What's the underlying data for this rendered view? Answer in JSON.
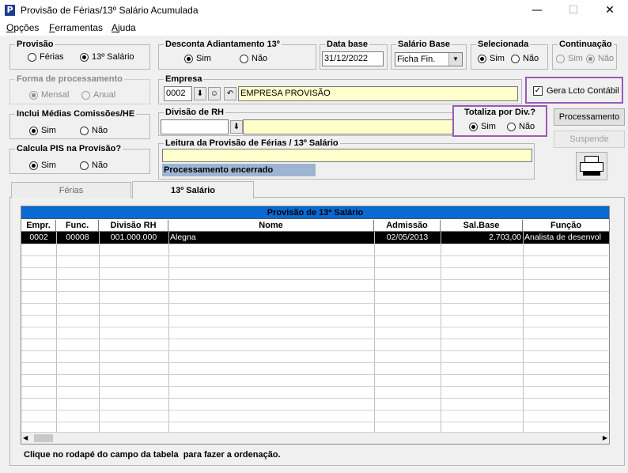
{
  "window": {
    "title": "Provisão de Férias/13º Salário Acumulada",
    "icon_letter": "P"
  },
  "menu": [
    "Opções",
    "Ferramentas",
    "Ajuda"
  ],
  "provisao": {
    "title": "Provisão",
    "opt1": "Férias",
    "opt2": "13º Salário",
    "selected": "13º Salário"
  },
  "desconta": {
    "title": "Desconta Adiantamento 13º",
    "opt1": "Sim",
    "opt2": "Não",
    "selected": "Sim"
  },
  "data_base": {
    "title": "Data base",
    "value": "31/12/2022"
  },
  "salario_base": {
    "title": "Salário Base",
    "value": "Ficha Fin."
  },
  "selecionada": {
    "title": "Selecionada",
    "opt1": "Sim",
    "opt2": "Não",
    "selected": "Sim"
  },
  "continuacao": {
    "title": "Continuação",
    "opt1": "Sim",
    "opt2": "Não",
    "selected": "Não",
    "disabled": true
  },
  "forma_processamento": {
    "title": "Forma de processamento",
    "opt1": "Mensal",
    "opt2": "Anual",
    "selected": "Mensal",
    "disabled": true
  },
  "empresa": {
    "title": "Empresa",
    "code": "0002",
    "name": "EMPRESA PROVISÃO"
  },
  "gera_lcto": {
    "label": "Gera Lcto Contábil",
    "checked": true
  },
  "inclui_medias": {
    "title": "Inclui Médias Comissões/HE",
    "opt1": "Sim",
    "opt2": "Não",
    "selected": "Sim"
  },
  "divisao_rh": {
    "title": "Divisão de RH",
    "code": "",
    "name": ""
  },
  "totaliza": {
    "title": "Totaliza por Div.?",
    "opt1": "Sim",
    "opt2": "Não",
    "selected": "Sim"
  },
  "buttons": {
    "processamento": "Processamento",
    "suspende": "Suspende"
  },
  "calcula_pis": {
    "title": "Calcula PIS na Provisão?",
    "opt1": "Sim",
    "opt2": "Não",
    "selected": "Sim"
  },
  "leitura": {
    "title": "Leitura da Provisão de Férias / 13º Salário",
    "value": "",
    "status": "Processamento encerrado"
  },
  "tabs": [
    "Férias",
    "13º Salário"
  ],
  "active_tab": "13º Salário",
  "table": {
    "caption": "Provisão de 13ª Salário",
    "columns": [
      "Empr.",
      "Func.",
      "Divisão RH",
      "Nome",
      "Admissão",
      "Sal.Base",
      "Função"
    ],
    "rows": [
      [
        "0002",
        "00008",
        "001.000.000",
        "Alegna",
        "02/05/2013",
        "2.703,00",
        "Analista de desenvol"
      ]
    ]
  },
  "footer": "Clique no rodapé do campo da tabela  para fazer a ordenação.",
  "colors": {
    "highlight": "#9b59b6",
    "caption_bg": "#0a6ad4",
    "yellow_field": "#ffffcc",
    "status_bg": "#9db4d3"
  }
}
